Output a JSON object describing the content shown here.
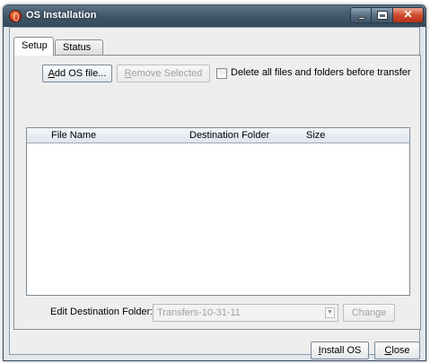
{
  "window": {
    "title": "OS Installation",
    "controls": {
      "minimize": "minimize",
      "maximize": "maximize",
      "close": "✕"
    }
  },
  "tabs": [
    {
      "label": "Setup",
      "active": true
    },
    {
      "label": "Status",
      "active": false
    }
  ],
  "setup": {
    "add_button": {
      "mnemonic": "A",
      "rest": "dd OS file..."
    },
    "remove_button": {
      "mnemonic": "R",
      "rest": "emove Selected"
    },
    "delete_checkbox": {
      "label": "Delete all files and folders before transfer",
      "checked": false
    },
    "table": {
      "columns": [
        "File Name",
        "Destination Folder",
        "Size"
      ],
      "rows": []
    },
    "destination": {
      "label": "Edit Destination Folder:",
      "value": "Transfers-10-31-11",
      "change_button": "Change"
    }
  },
  "footer": {
    "install_button": {
      "mnemonic": "I",
      "rest": "nstall OS"
    },
    "close_button": {
      "mnemonic": "C",
      "rest": "lose"
    }
  },
  "colors": {
    "titlebar": "#3f5467",
    "close_button": "#cf4b2e",
    "window_bg": "#eeeeee"
  }
}
